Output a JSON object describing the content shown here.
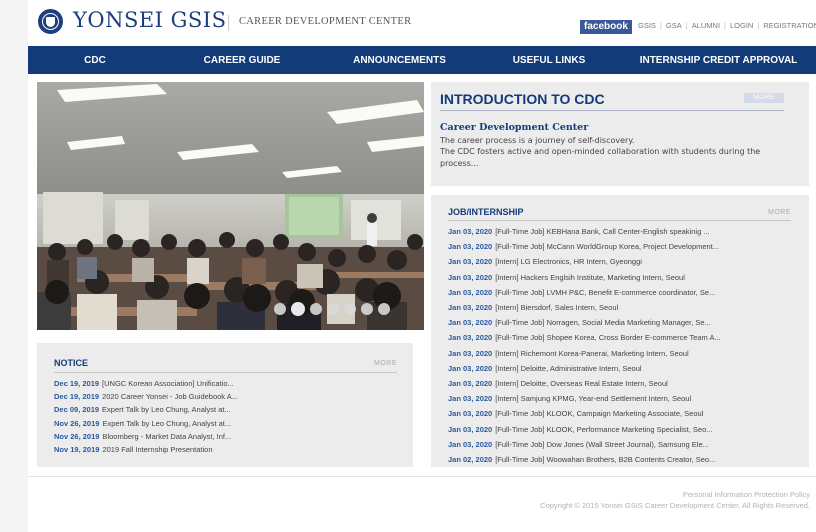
{
  "header": {
    "logo_text": "YONSEI GSIS",
    "logo_sub": "CAREER DEVELOPMENT CENTER",
    "facebook_label": "facebook",
    "top_links": [
      "GSIS",
      "GSA",
      "ALUMNI",
      "LOGIN",
      "REGISTRATION"
    ],
    "seal_icon": "yonsei-seal-icon"
  },
  "nav": {
    "items": [
      "CDC",
      "CAREER GUIDE",
      "ANNOUNCEMENTS",
      "USEFUL LINKS",
      "INTERNSHIP CREDIT APPROVAL"
    ]
  },
  "slideshow": {
    "dots": 7,
    "active_dot": 2
  },
  "intro": {
    "title": "INTRODUCTION TO CDC",
    "more_label": "MORE",
    "heading": "Career Development Center",
    "body": "The career process is a journey of self-discovery.\nThe CDC fosters active and open-minded collaboration with students during the process..."
  },
  "notice": {
    "title": "NOTICE",
    "more_label": "MORE",
    "items": [
      {
        "date": "Dec 19, 2019",
        "text": "[UNGC Korean Association] Unificatio..."
      },
      {
        "date": "Dec 19, 2019",
        "text": "2020 Career Yonsei - Job Guidebook A..."
      },
      {
        "date": "Dec 09, 2019",
        "text": "Expert Talk by Leo Chung, Analyst at..."
      },
      {
        "date": "Nov 26, 2019",
        "text": "Expert Talk by Leo Chung, Analyst at..."
      },
      {
        "date": "Nov 26, 2019",
        "text": "Bloomberg - Market Data Analyst, Inf..."
      },
      {
        "date": "Nov 19, 2019",
        "text": "2019 Fall Internship Presentation"
      }
    ]
  },
  "jobs": {
    "title": "JOB/INTERNSHIP",
    "more_label": "MORE",
    "items": [
      {
        "date": "Jan 03, 2020",
        "text": "[Full-Time Job] KEBHana Bank, Call Center-English speakinig ..."
      },
      {
        "date": "Jan 03, 2020",
        "text": "[Full-Time Job] McCann WorldGroup Korea, Project Development..."
      },
      {
        "date": "Jan 03, 2020",
        "text": "[Intern] LG Electronics, HR Intern, Gyeonggi"
      },
      {
        "date": "Jan 03, 2020",
        "text": "[Intern] Hackers Englsih Institute, Marketing Intern, Seoul"
      },
      {
        "date": "Jan 03, 2020",
        "text": "[Full-Time Job] LVMH P&C, Benefit E-commerce coordinator, Se..."
      },
      {
        "date": "Jan 03, 2020",
        "text": "[Intern] Biersdorf, Sales Intern, Seoul"
      },
      {
        "date": "Jan 03, 2020",
        "text": "[Full-Time Job] Norragen, Social Media Marketing Manager, Se..."
      },
      {
        "date": "Jan 03, 2020",
        "text": "[Full-Time Job] Shopee Korea, Cross Border E-commerce Team A..."
      },
      {
        "date": "Jan 03, 2020",
        "text": "[Intern] Richemont Korea-Panerai, Marketing Intern, Seoul"
      },
      {
        "date": "Jan 03, 2020",
        "text": "[Intern] Deloitte, Administrative Intern, Seoul"
      },
      {
        "date": "Jan 03, 2020",
        "text": "[Intern] Deloitte, Overseas Real Estate Intern, Seoul"
      },
      {
        "date": "Jan 03, 2020",
        "text": "[Intern] Samjung KPMG, Year-end Settlement Intern, Seoul"
      },
      {
        "date": "Jan 03, 2020",
        "text": "[Full-Time Job] KLOOK, Campaign Marketing Associate, Seoul"
      },
      {
        "date": "Jan 03, 2020",
        "text": "[Full-Time Job] KLOOK, Performance Marketing Specialist, Seo..."
      },
      {
        "date": "Jan 03, 2020",
        "text": "[Full-Time Job] Dow Jones (Wall Street Journal), Samsung Ele..."
      },
      {
        "date": "Jan 02, 2020",
        "text": "[Full-Time Job] Woowahan Brothers, B2B Contents Creator, Seo..."
      }
    ]
  },
  "footer": {
    "policy": "Personal Information Protection Policy",
    "copyright": "Copyright © 2015 Yonsei GSIS Career Development Center. All Rights Reserved."
  },
  "colors": {
    "brand_navy": "#123b7a",
    "date_blue": "#2c5aa0",
    "facebook": "#3b5998"
  }
}
